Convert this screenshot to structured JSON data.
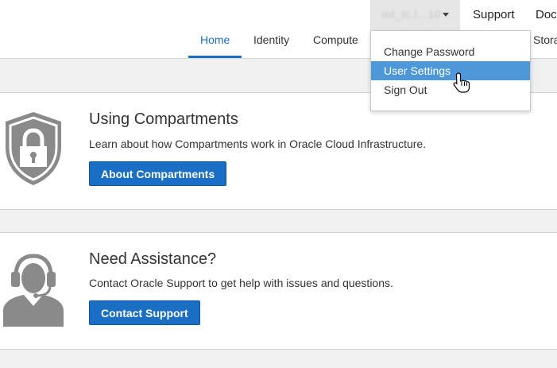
{
  "header": {
    "user_name": "int_tc.l...10",
    "links": {
      "support": "Support",
      "documentation": "Docu"
    }
  },
  "nav": {
    "tabs": [
      "Home",
      "Identity",
      "Compute",
      "Stora"
    ],
    "active_tab": "Home"
  },
  "user_dropdown": {
    "items": [
      "Change Password",
      "User Settings",
      "Sign Out"
    ],
    "highlighted": "User Settings"
  },
  "cards": [
    {
      "title": "Using Compartments",
      "description": "Learn about how Compartments work in Oracle Cloud Infrastructure.",
      "button_label": "About Compartments",
      "icon": "shield-lock-icon"
    },
    {
      "title": "Need Assistance?",
      "description": "Contact Oracle Support to get help with issues and questions.",
      "button_label": "Contact Support",
      "icon": "support-agent-icon"
    }
  ],
  "colors": {
    "accent": "#1a6fc4",
    "menu_highlight": "#4d98d9",
    "icon_gray": "#8a8a8a",
    "page_bg": "#f0f0f0"
  }
}
